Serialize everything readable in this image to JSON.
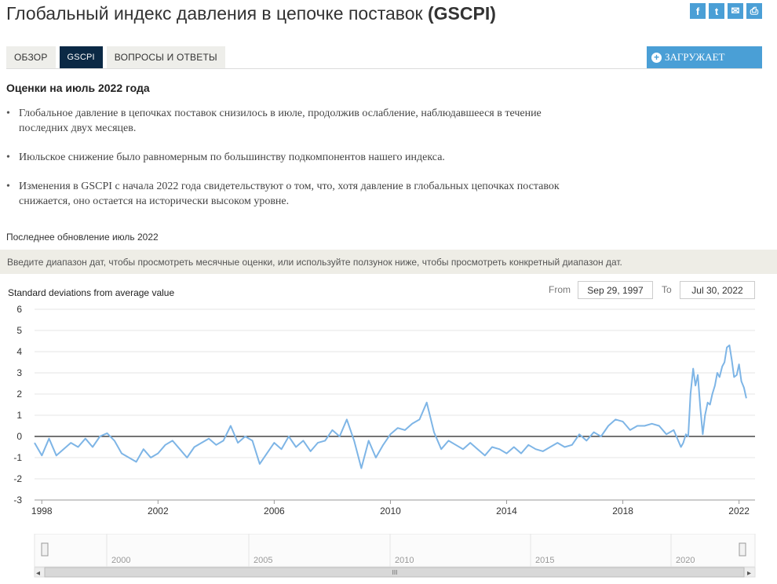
{
  "header": {
    "title": "Глобальный индекс давления в цепочке поставок",
    "title_abbr": "(GSCPI)",
    "share": [
      {
        "icon": "facebook-icon",
        "glyph": "f"
      },
      {
        "icon": "twitter-icon",
        "glyph": "t"
      },
      {
        "icon": "email-icon",
        "glyph": "✉"
      },
      {
        "icon": "print-icon",
        "glyph": "⎙"
      }
    ],
    "share_color": "#4a9fd6"
  },
  "tabs": [
    {
      "label": "ОБЗОР",
      "active": false
    },
    {
      "label": "GSCPI",
      "active": true
    },
    {
      "label": "ВОПРОСЫ И ОТВЕТЫ",
      "active": false
    }
  ],
  "download": {
    "label": "ЗАГРУЖАЕТ",
    "icon": "plus-circle-icon"
  },
  "subheading": "Оценки на июль 2022 года",
  "bullets": [
    "Глобальное давление в цепочках поставок снизилось в июле, продолжив ослабление, наблюдавшееся в течение последних двух месяцев.",
    "Июльское снижение было равномерным по большинству подкомпонентов нашего индекса.",
    "Изменения в GSCPI с начала 2022 года свидетельствуют о том, что, хотя давление в глобальных цепочках поставок снижается, оно остается на исторически высоком уровне."
  ],
  "updated": "Последнее обновление июль 2022",
  "instruction": "Введите диапазон дат, чтобы просмотреть месячные оценки, или используйте ползунок ниже, чтобы просмотреть конкретный диапазон дат.",
  "range": {
    "from_label": "From",
    "from_value": "Sep 29, 1997",
    "to_label": "To",
    "to_value": "Jul 30, 2022"
  },
  "navigator": {
    "labels": [
      "2000",
      "2005",
      "2010",
      "2015",
      "2020"
    ],
    "scroll_grip": "III",
    "left_arrow": "◂",
    "right_arrow": "▸"
  },
  "chart_data": {
    "type": "line",
    "ylabel": "Standard deviations from average value",
    "ylim": [
      -3,
      6
    ],
    "yticks": [
      -3,
      -2,
      -1,
      0,
      1,
      2,
      3,
      4,
      5,
      6
    ],
    "xlim": [
      1997.75,
      2022.55
    ],
    "xticks": [
      1998,
      2002,
      2006,
      2010,
      2014,
      2018,
      2022
    ],
    "grid": true,
    "line_color": "#7eb5e6",
    "x": [
      1997.75,
      1998.0,
      1998.25,
      1998.5,
      1998.75,
      1999.0,
      1999.25,
      1999.5,
      1999.75,
      2000.0,
      2000.25,
      2000.5,
      2000.75,
      2001.0,
      2001.25,
      2001.5,
      2001.75,
      2002.0,
      2002.25,
      2002.5,
      2002.75,
      2003.0,
      2003.25,
      2003.5,
      2003.75,
      2004.0,
      2004.25,
      2004.5,
      2004.75,
      2005.0,
      2005.25,
      2005.5,
      2005.75,
      2006.0,
      2006.25,
      2006.5,
      2006.75,
      2007.0,
      2007.25,
      2007.5,
      2007.75,
      2008.0,
      2008.25,
      2008.5,
      2008.75,
      2009.0,
      2009.25,
      2009.5,
      2009.75,
      2010.0,
      2010.25,
      2010.5,
      2010.75,
      2011.0,
      2011.25,
      2011.5,
      2011.75,
      2012.0,
      2012.25,
      2012.5,
      2012.75,
      2013.0,
      2013.25,
      2013.5,
      2013.75,
      2014.0,
      2014.25,
      2014.5,
      2014.75,
      2015.0,
      2015.25,
      2015.5,
      2015.75,
      2016.0,
      2016.25,
      2016.5,
      2016.75,
      2017.0,
      2017.25,
      2017.5,
      2017.75,
      2018.0,
      2018.25,
      2018.5,
      2018.75,
      2019.0,
      2019.25,
      2019.5,
      2019.75,
      2020.0,
      2020.08,
      2020.17,
      2020.25,
      2020.33,
      2020.42,
      2020.5,
      2020.58,
      2020.67,
      2020.75,
      2020.83,
      2020.92,
      2021.0,
      2021.08,
      2021.17,
      2021.25,
      2021.33,
      2021.42,
      2021.5,
      2021.58,
      2021.67,
      2021.75,
      2021.83,
      2021.92,
      2022.0,
      2022.08,
      2022.17,
      2022.25,
      2022.33,
      2022.42,
      2022.5,
      2022.55
    ],
    "values": [
      -0.3,
      -0.9,
      -0.1,
      -0.9,
      -0.6,
      -0.3,
      -0.5,
      -0.1,
      -0.5,
      0.0,
      0.15,
      -0.2,
      -0.8,
      -1.0,
      -1.2,
      -0.6,
      -1.0,
      -0.8,
      -0.4,
      -0.2,
      -0.6,
      -1.0,
      -0.5,
      -0.3,
      -0.1,
      -0.4,
      -0.2,
      0.5,
      -0.3,
      0.0,
      -0.2,
      -1.3,
      -0.8,
      -0.3,
      -0.6,
      0.0,
      -0.5,
      -0.2,
      -0.7,
      -0.3,
      -0.2,
      0.3,
      0.0,
      0.8,
      -0.2,
      -1.5,
      -0.2,
      -1.0,
      -0.4,
      0.1,
      0.4,
      0.3,
      0.6,
      0.8,
      1.6,
      0.2,
      -0.6,
      -0.2,
      -0.4,
      -0.6,
      -0.3,
      -0.6,
      -0.9,
      -0.5,
      -0.6,
      -0.8,
      -0.5,
      -0.8,
      -0.4,
      -0.6,
      -0.7,
      -0.5,
      -0.3,
      -0.5,
      -0.4,
      0.1,
      -0.2,
      0.2,
      0.0,
      0.5,
      0.8,
      0.7,
      0.3,
      0.5,
      0.5,
      0.6,
      0.5,
      0.1,
      0.3,
      -0.5,
      -0.3,
      0.1,
      0.0,
      2.0,
      3.2,
      2.4,
      2.9,
      1.3,
      0.1,
      1.0,
      1.6,
      1.5,
      2.0,
      2.4,
      3.0,
      2.8,
      3.3,
      3.5,
      4.2,
      4.3,
      3.6,
      2.8,
      2.9,
      3.4,
      2.6,
      2.3,
      1.8
    ]
  }
}
